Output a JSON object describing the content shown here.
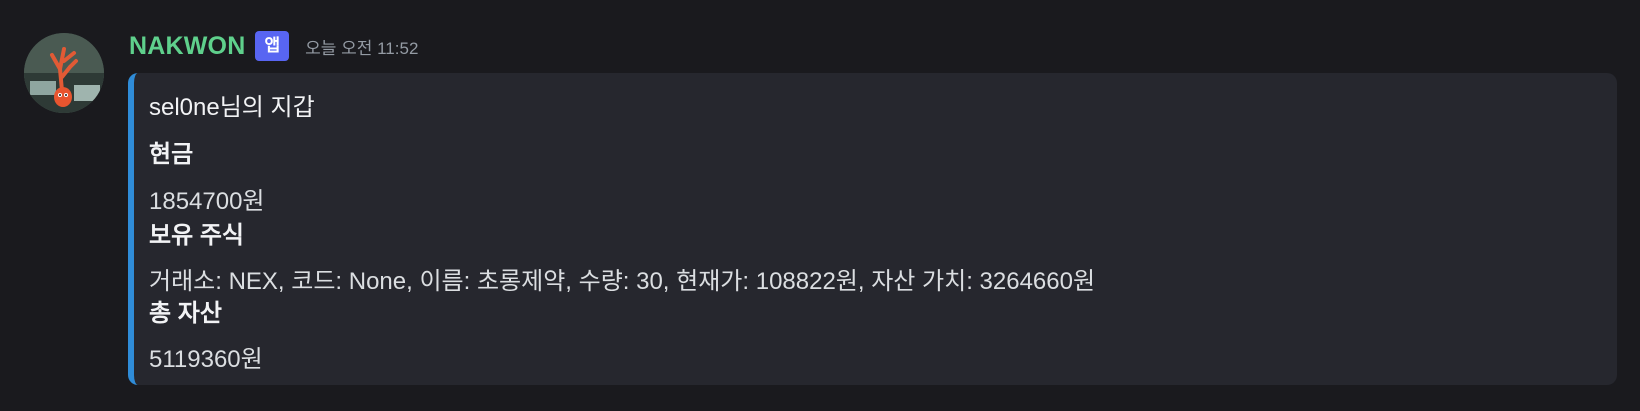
{
  "message": {
    "author": "NAKWON",
    "badge": "앱",
    "timestamp": "오늘 오전 11:52",
    "avatar_icon": "coral-character-avatar"
  },
  "embed": {
    "accent_color": "#2f8cd8",
    "title": "sel0ne님의 지갑",
    "fields": [
      {
        "name": "현금",
        "value": "1854700원"
      },
      {
        "name": "보유 주식",
        "value": "거래소: NEX, 코드: None, 이름: 초롱제약, 수량: 30, 현재가: 108822원, 자산 가치: 3264660원"
      },
      {
        "name": "총 자산",
        "value": "5119360원"
      }
    ]
  },
  "colors": {
    "background": "#1a1a1e",
    "username": "#5fd08c",
    "badge": "#5865f2",
    "embed_background": "#26272e"
  }
}
